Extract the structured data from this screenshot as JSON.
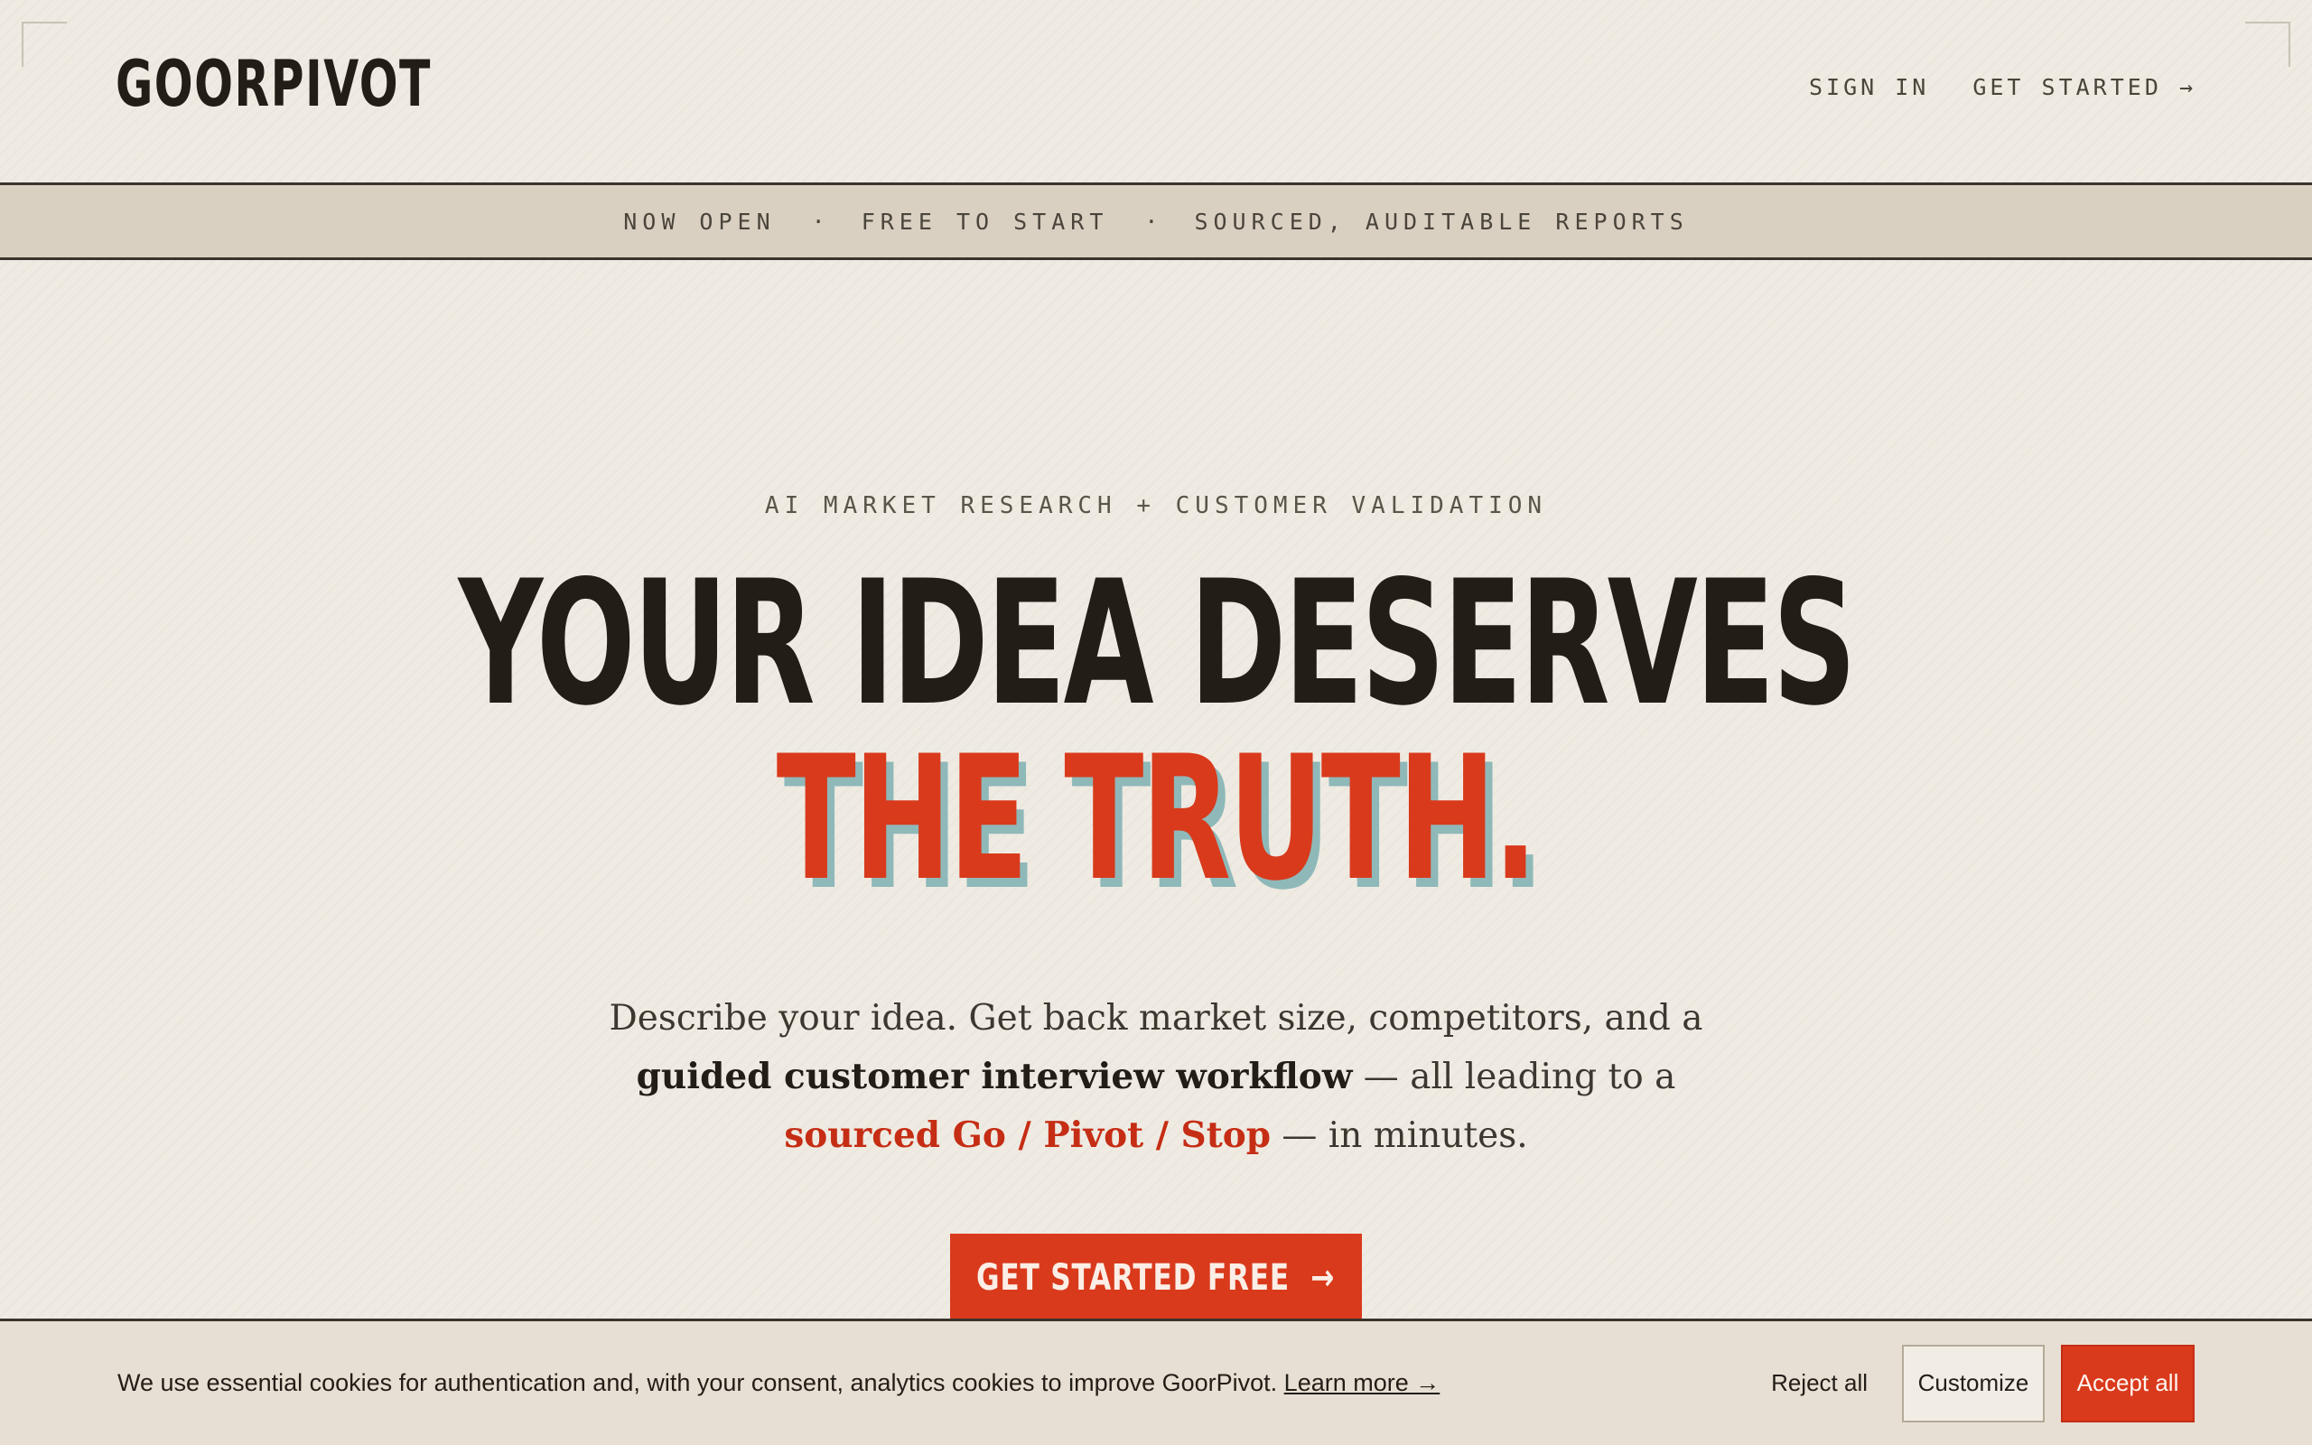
{
  "header": {
    "logo": "GOORPIVOT",
    "nav": [
      {
        "label": "SIGN IN"
      },
      {
        "label": "GET STARTED →"
      }
    ]
  },
  "banner": {
    "items": [
      "NOW OPEN",
      "FREE TO START",
      "SOURCED, AUDITABLE REPORTS"
    ],
    "separator": "·"
  },
  "hero": {
    "eyebrow": "AI MARKET RESEARCH + CUSTOMER VALIDATION",
    "headline_line1": "YOUR IDEA DESERVES",
    "headline_line2": "THE TRUTH.",
    "sub": {
      "p1": "Describe your idea. Get back market size, competitors, and a ",
      "bold": "guided customer interview workflow",
      "p2": " — all leading to a ",
      "accent": "sourced Go / Pivot / Stop",
      "p3": " — in minutes."
    },
    "cta_label": "GET STARTED FREE",
    "cta_arrow": "→"
  },
  "cookie": {
    "message": "We use essential cookies for authentication and, with your consent, analytics cookies to improve GoorPivot. ",
    "link": "Learn more →",
    "reject": "Reject all",
    "customize": "Customize",
    "accept": "Accept all"
  },
  "colors": {
    "background": "#efebe2",
    "ink": "#221d17",
    "accent": "#d93a1c",
    "shadow_teal": "#8fb8b9",
    "banner_bg": "#d9d0c1"
  }
}
